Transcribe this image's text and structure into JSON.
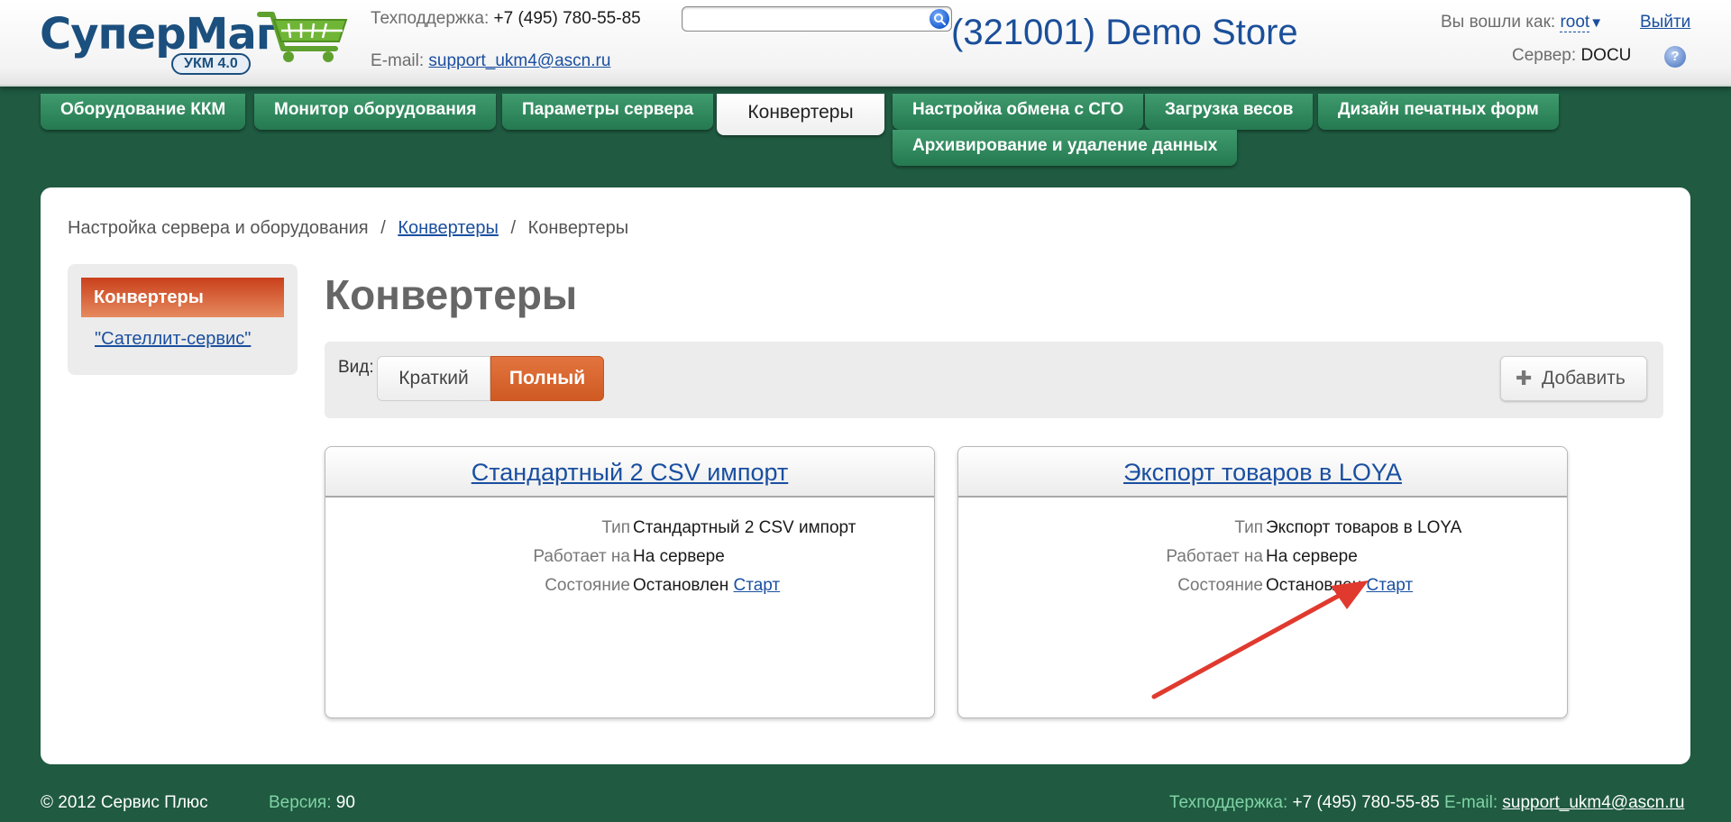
{
  "header": {
    "logo_text_1": "Супер",
    "logo_text_2": "Маг",
    "logo_badge": "УКМ 4.0",
    "support_label": "Техподдержка:",
    "support_phone": "+7 (495) 780-55-85",
    "email_label": "E-mail:",
    "email_value": "support_ukm4@ascn.ru",
    "search_placeholder": "",
    "store_title": "(321001) Demo Store",
    "user_label": "Вы вошли как:",
    "user_name": "root",
    "logout": "Выйти",
    "server_label": "Сервер:",
    "server_value": "DOCU",
    "help": "?"
  },
  "nav": {
    "tabs": [
      {
        "label": "Оборудование ККМ"
      },
      {
        "label": "Монитор оборудования"
      },
      {
        "label": "Параметры сервера"
      },
      {
        "label": "Конвертеры"
      },
      {
        "label": "Настройка обмена с СГО"
      },
      {
        "label": "Загрузка весов"
      },
      {
        "label": "Дизайн печатных форм"
      },
      {
        "label": "Архивирование и удаление данных"
      }
    ],
    "active_index": 3
  },
  "breadcrumb": {
    "root": "Настройка сервера и оборудования",
    "sep": "/",
    "link": "Конвертеры",
    "current": "Конвертеры"
  },
  "sidebar": {
    "active_item": "Конвертеры",
    "link_item": "\"Сателлит-сервис\""
  },
  "main": {
    "title": "Конвертеры",
    "view_label": "Вид:",
    "view_short": "Краткий",
    "view_full": "Полный",
    "add_button": "Добавить"
  },
  "cards": [
    {
      "title": "Стандартный 2 CSV импорт",
      "rows": [
        {
          "key": "Тип",
          "value": "Стандартный 2 CSV импорт"
        },
        {
          "key": "Работает на",
          "value": "На сервере"
        },
        {
          "key": "Состояние",
          "value": "Остановлен",
          "action": "Старт"
        }
      ]
    },
    {
      "title": "Экспорт товаров в LOYA",
      "rows": [
        {
          "key": "Тип",
          "value": "Экспорт товаров в LOYA"
        },
        {
          "key": "Работает на",
          "value": "На сервере"
        },
        {
          "key": "Состояние",
          "value": "Остановлен",
          "action": "Старт"
        }
      ]
    }
  ],
  "footer": {
    "copyright": "© 2012 Сервис Плюс",
    "version_label": "Версия:",
    "version_value": "90",
    "support_label": "Техподдержка:",
    "support_phone": "+7 (495) 780-55-85",
    "email_label": "E-mail:",
    "email_value": "support_ukm4@ascn.ru"
  },
  "colors": {
    "background": "#1f5a41",
    "nav_tab": "#2e8a5c",
    "accent_orange": "#d9642d",
    "link": "#1a4fa0",
    "annotation_arrow": "#e03a2f"
  }
}
